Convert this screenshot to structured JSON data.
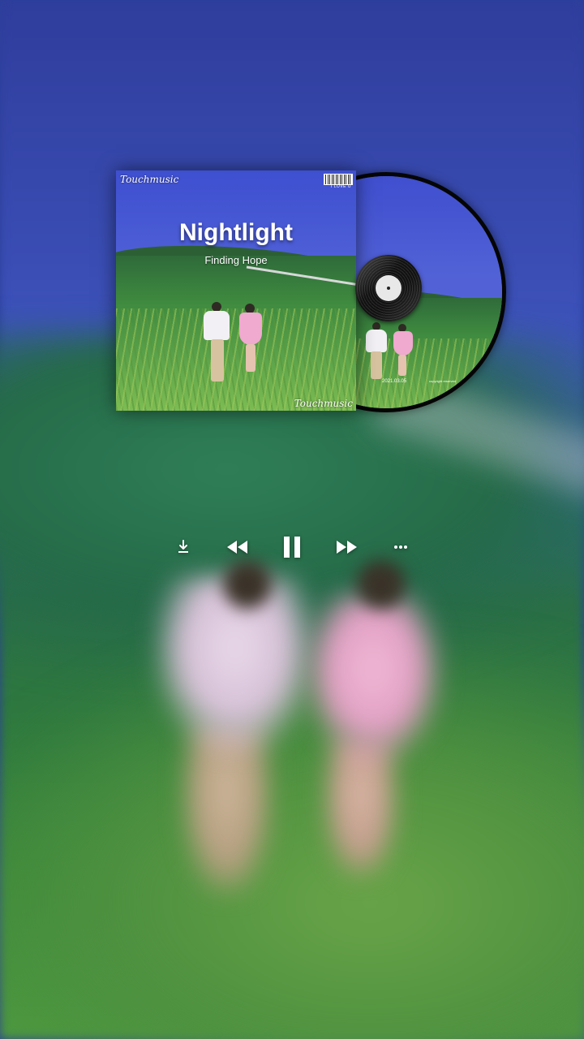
{
  "album": {
    "brand_top": "Touchmusic",
    "barcode_text": "I LOVE U",
    "title": "Nightlight",
    "subtitle": "Finding Hope",
    "brand_bottom": "Touchmusic"
  },
  "disc": {
    "date_text": "2021.03.05",
    "small_text": "copyright reserved"
  },
  "controls": {
    "download_icon": "download-icon",
    "previous_icon": "rewind-icon",
    "play_state_icon": "pause-icon",
    "next_icon": "fast-forward-icon",
    "more_icon": "more-icon"
  },
  "colors": {
    "icon": "#ffffff",
    "sky": "#3e4fd0",
    "grass": "#3e8a3f"
  }
}
